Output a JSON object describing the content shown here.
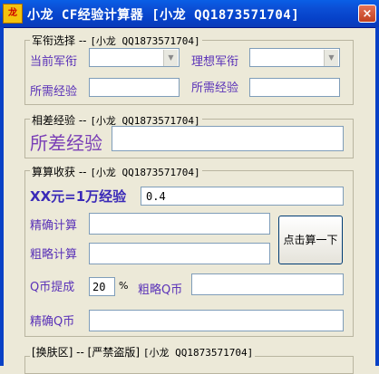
{
  "window": {
    "title": "小龙 CF经验计算器 [小龙 QQ1873571704]",
    "close_glyph": "×",
    "icon_glyph": "龙"
  },
  "rank_group": {
    "legend_label": "军衔选择 --",
    "legend_qq": "[小龙 QQ1873571704]",
    "current_rank_label": "当前军衔",
    "target_rank_label": "理想军衔",
    "current_rank_value": "",
    "target_rank_value": "",
    "required_exp_label_1": "所需经验",
    "required_exp_label_2": "所需经验",
    "required_exp_value_1": "",
    "required_exp_value_2": ""
  },
  "diff_group": {
    "legend_label": "相差经验 --",
    "legend_qq": "[小龙 QQ1873571704]",
    "diff_label": "所差经验",
    "diff_value": ""
  },
  "calc_group": {
    "legend_label": "算算收获 --",
    "legend_qq": "[小龙 QQ1873571704]",
    "rate_label": "XX元=1万经验",
    "rate_value": "0.4",
    "precise_calc_label": "精确计算",
    "precise_calc_value": "",
    "rough_calc_label": "粗略计算",
    "rough_calc_value": "",
    "calc_button": "点击算一下",
    "q_coin_rate_label": "Q币提成",
    "q_coin_rate_value": "20",
    "q_coin_rate_unit": "%",
    "rough_q_coin_label": "粗略Q币",
    "rough_q_coin_value": "",
    "precise_q_coin_label": "精确Q币",
    "precise_q_coin_value": ""
  },
  "skin_group": {
    "legend_label": "[换肤区] -- [严禁盗版]",
    "legend_qq": "[小龙 QQ1873571704]"
  }
}
